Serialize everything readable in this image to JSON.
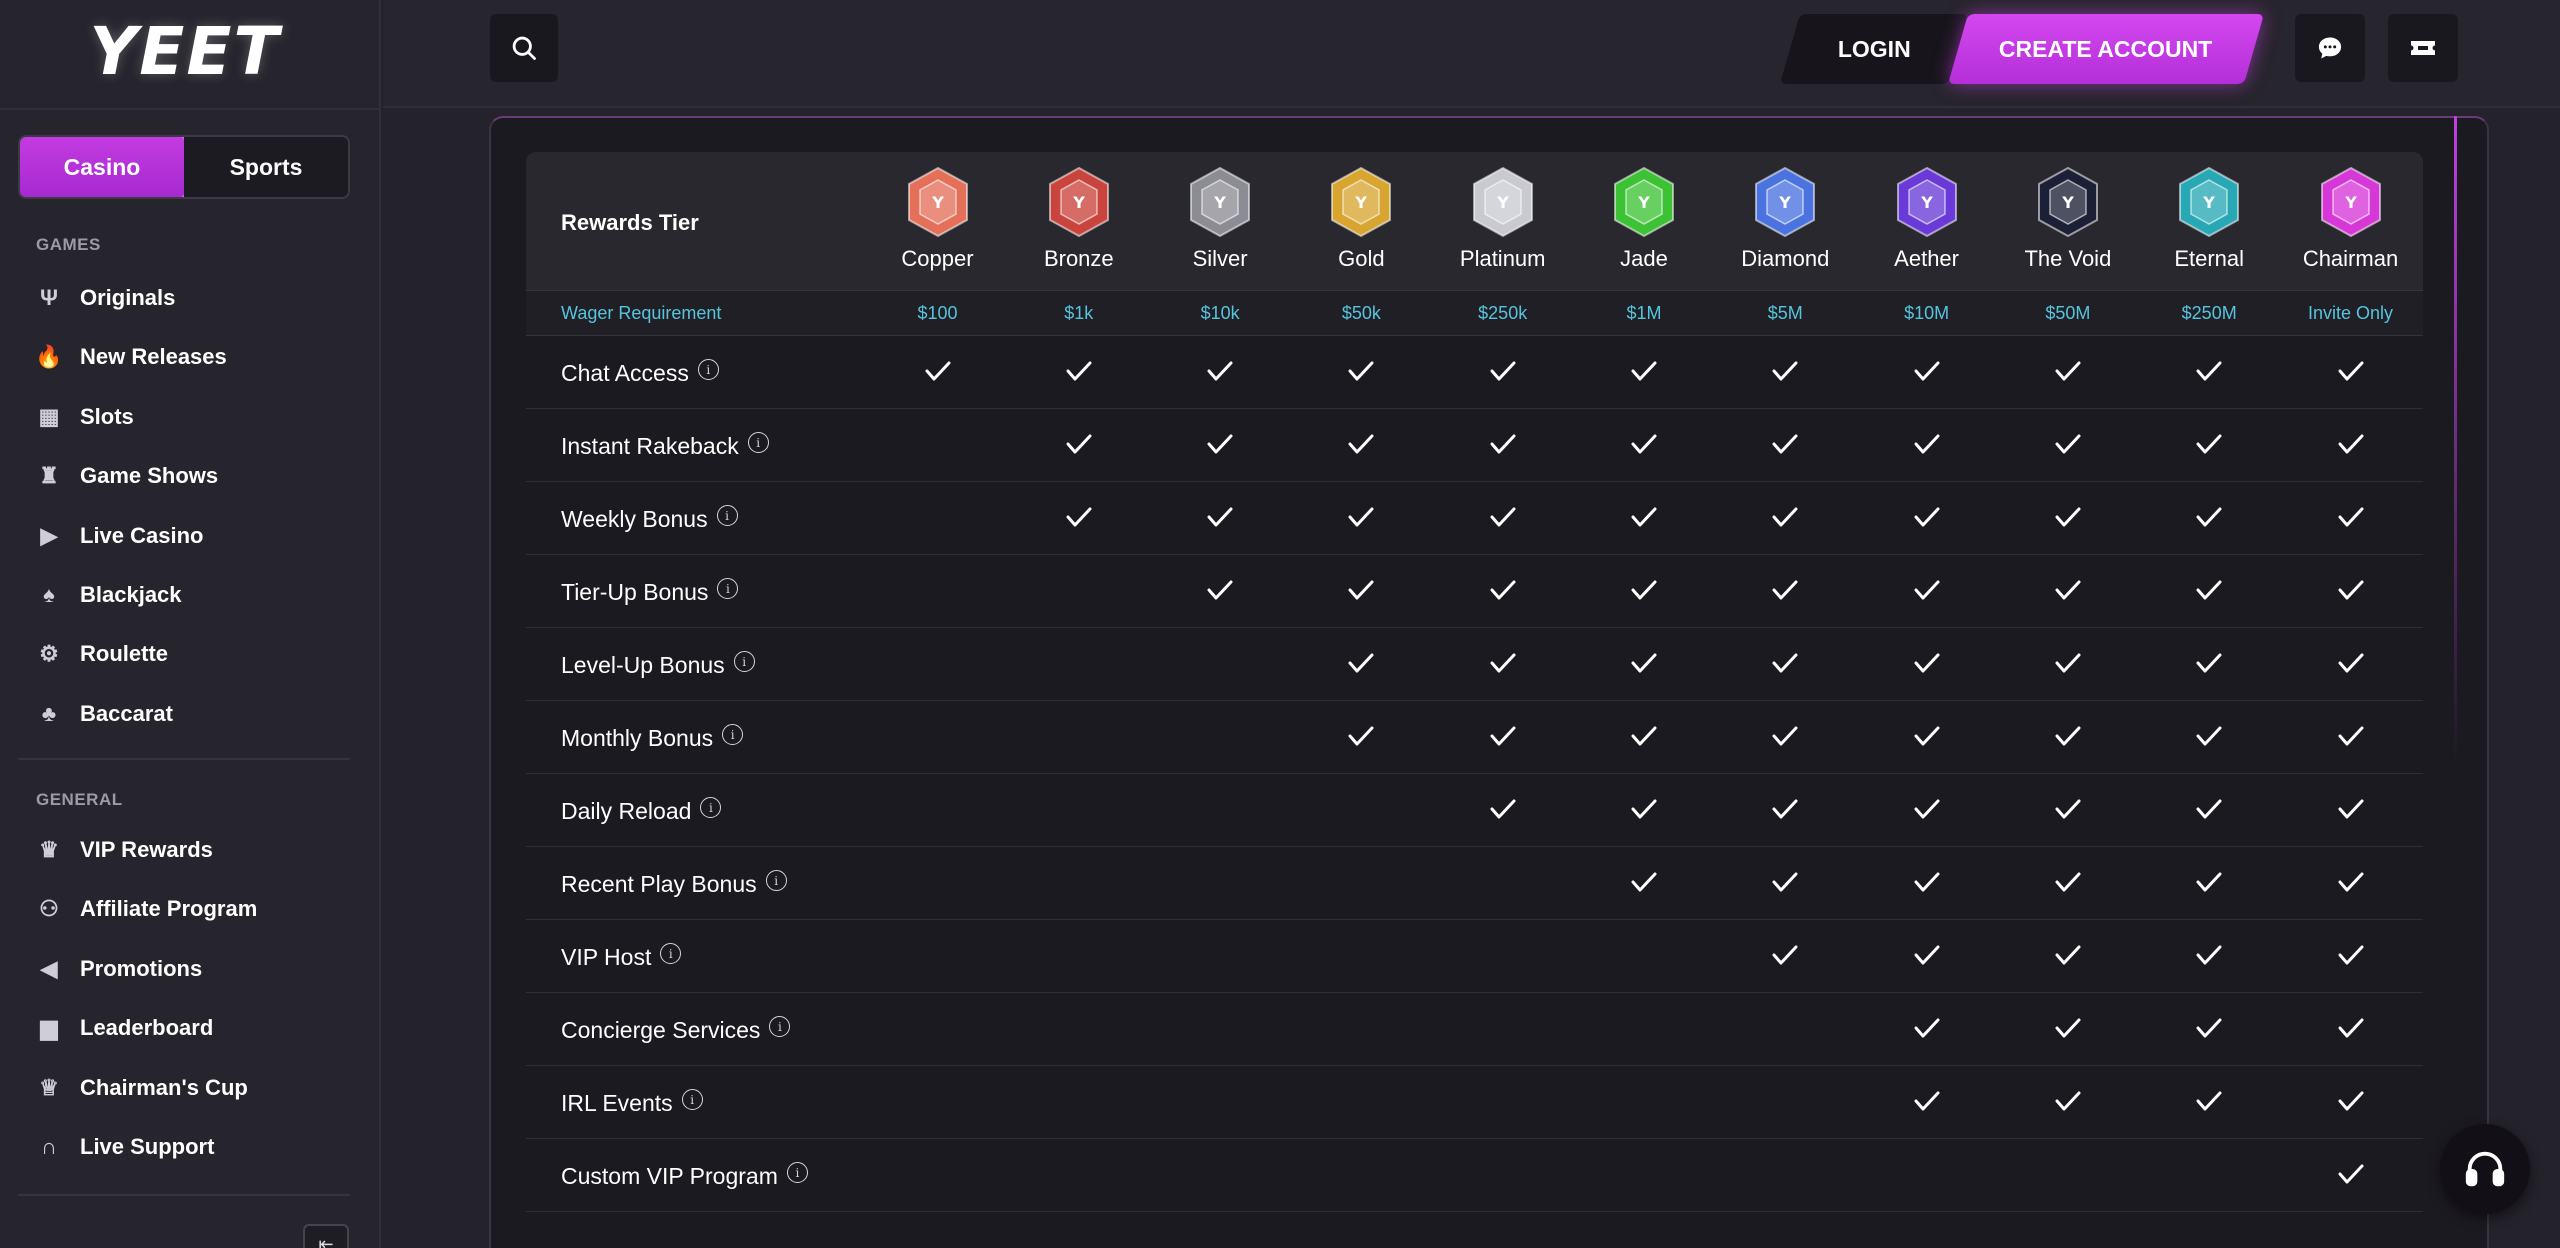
{
  "logo": "YEET",
  "sidebar": {
    "toggle": {
      "casino": "Casino",
      "sports": "Sports"
    },
    "games_label": "GAMES",
    "games": [
      {
        "label": "Originals",
        "icon": "originals-icon"
      },
      {
        "label": "New Releases",
        "icon": "flame-icon"
      },
      {
        "label": "Slots",
        "icon": "slots-icon"
      },
      {
        "label": "Game Shows",
        "icon": "game-shows-icon"
      },
      {
        "label": "Live Casino",
        "icon": "live-icon"
      },
      {
        "label": "Blackjack",
        "icon": "cards-icon"
      },
      {
        "label": "Roulette",
        "icon": "roulette-icon"
      },
      {
        "label": "Baccarat",
        "icon": "baccarat-icon"
      }
    ],
    "general_label": "GENERAL",
    "general": [
      {
        "label": "VIP Rewards",
        "icon": "crown-icon"
      },
      {
        "label": "Affiliate Program",
        "icon": "affiliate-icon"
      },
      {
        "label": "Promotions",
        "icon": "megaphone-icon"
      },
      {
        "label": "Leaderboard",
        "icon": "leaderboard-icon"
      },
      {
        "label": "Chairman's Cup",
        "icon": "trophy-icon"
      },
      {
        "label": "Live Support",
        "icon": "headset-icon"
      }
    ]
  },
  "header": {
    "login": "LOGIN",
    "create_account": "CREATE ACCOUNT"
  },
  "table": {
    "tier_header": "Rewards Tier",
    "wager_label": "Wager Requirement",
    "tiers": [
      {
        "name": "Copper",
        "wager": "$100",
        "color": "#e4705a"
      },
      {
        "name": "Bronze",
        "wager": "$1k",
        "color": "#c9443c"
      },
      {
        "name": "Silver",
        "wager": "$10k",
        "color": "#8c8c94"
      },
      {
        "name": "Gold",
        "wager": "$50k",
        "color": "#d8a531"
      },
      {
        "name": "Platinum",
        "wager": "$250k",
        "color": "#c9c9d2"
      },
      {
        "name": "Jade",
        "wager": "$1M",
        "color": "#3ec235"
      },
      {
        "name": "Diamond",
        "wager": "$5M",
        "color": "#4a73e0"
      },
      {
        "name": "Aether",
        "wager": "$10M",
        "color": "#6a3ad8"
      },
      {
        "name": "The Void",
        "wager": "$50M",
        "color": "#1c2036"
      },
      {
        "name": "Eternal",
        "wager": "$250M",
        "color": "#27a8b4"
      },
      {
        "name": "Chairman",
        "wager": "Invite Only",
        "color": "#d638d8"
      }
    ],
    "features": [
      {
        "label": "Chat Access",
        "start": 0
      },
      {
        "label": "Instant Rakeback",
        "start": 1
      },
      {
        "label": "Weekly Bonus",
        "start": 1
      },
      {
        "label": "Tier-Up Bonus",
        "start": 2
      },
      {
        "label": "Level-Up Bonus",
        "start": 3
      },
      {
        "label": "Monthly Bonus",
        "start": 3
      },
      {
        "label": "Daily Reload",
        "start": 4
      },
      {
        "label": "Recent Play Bonus",
        "start": 5
      },
      {
        "label": "VIP Host",
        "start": 6
      },
      {
        "label": "Concierge Services",
        "start": 7
      },
      {
        "label": "IRL Events",
        "start": 7
      },
      {
        "label": "Custom VIP Program",
        "start": 10
      }
    ]
  },
  "colors": {
    "accent": "#c33be0",
    "wager_text": "#55c4dd",
    "background": "#24222a"
  }
}
